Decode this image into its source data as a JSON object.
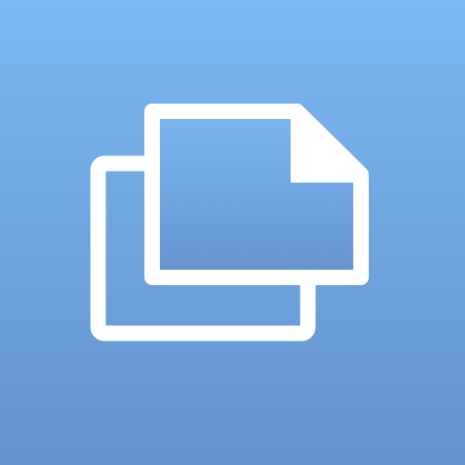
{
  "icon": {
    "name": "copy-documents-icon",
    "background_gradient": {
      "top": "#7bb8f3",
      "bottom": "#6492cc"
    },
    "glyph_color": "#ffffff"
  }
}
